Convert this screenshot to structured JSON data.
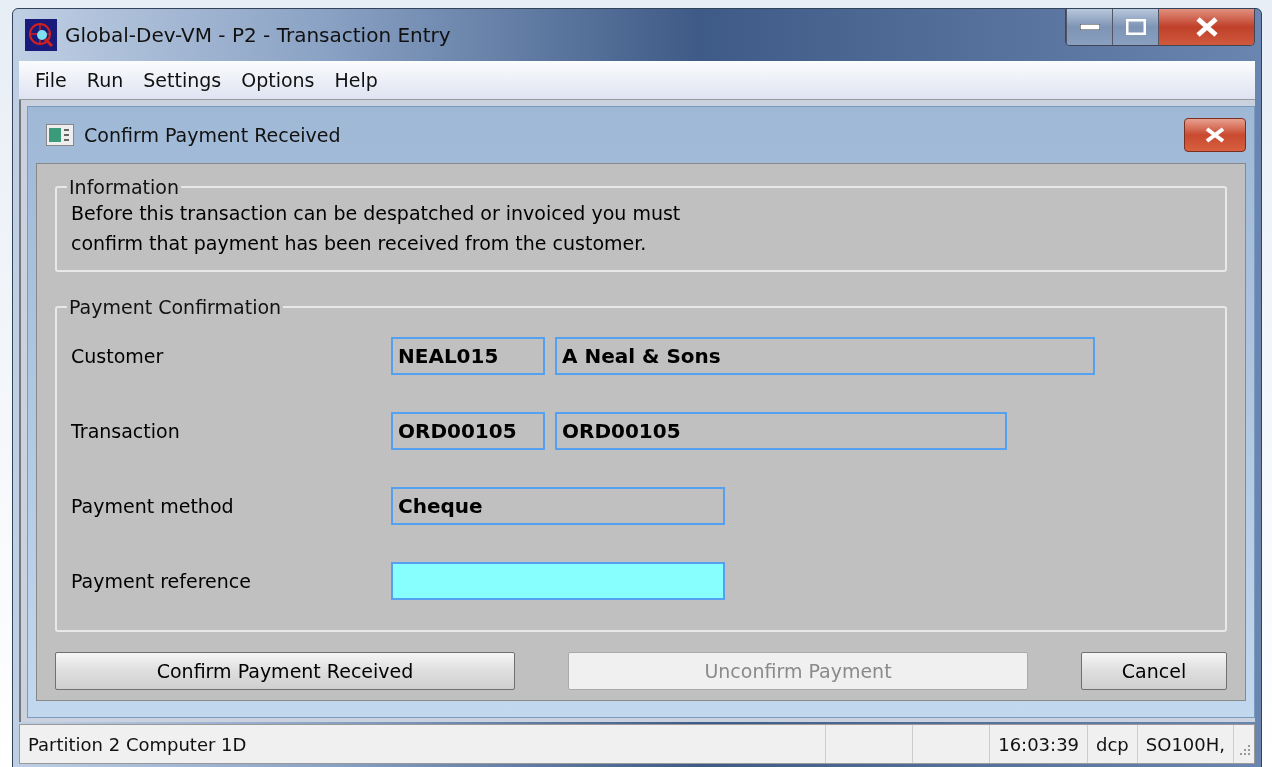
{
  "window": {
    "title": "Global-Dev-VM - P2 - Transaction Entry"
  },
  "menu": [
    "File",
    "Run",
    "Settings",
    "Options",
    "Help"
  ],
  "dialog": {
    "title": "Confirm Payment Received",
    "information": {
      "legend": "Information",
      "lines": [
        "Before this transaction can be despatched or invoiced you must",
        "confirm that payment has been received from the customer."
      ]
    },
    "confirmation": {
      "legend": "Payment Confirmation",
      "rows": [
        {
          "label": "Customer",
          "fields": [
            {
              "value": "NEAL015",
              "highlighted": false
            },
            {
              "value": "A Neal & Sons",
              "highlighted": false
            }
          ]
        },
        {
          "label": "Transaction",
          "fields": [
            {
              "value": "ORD00105",
              "highlighted": false
            },
            {
              "value": "ORD00105",
              "highlighted": false
            }
          ]
        },
        {
          "label": "Payment method",
          "fields": [
            {
              "value": "Cheque",
              "highlighted": false
            }
          ]
        },
        {
          "label": "Payment reference",
          "fields": [
            {
              "highlighted": true
            }
          ]
        }
      ]
    },
    "buttons": [
      {
        "label": "Confirm Payment Received",
        "disabled": false
      },
      {
        "label": "Unconfirm Payment",
        "disabled": true
      },
      {
        "label": "Cancel",
        "disabled": false
      }
    ]
  },
  "status_bar": {
    "message": "Partition 2 Computer 1D",
    "panes": [
      "16:03:39",
      "dcp",
      "SO100H,"
    ]
  }
}
